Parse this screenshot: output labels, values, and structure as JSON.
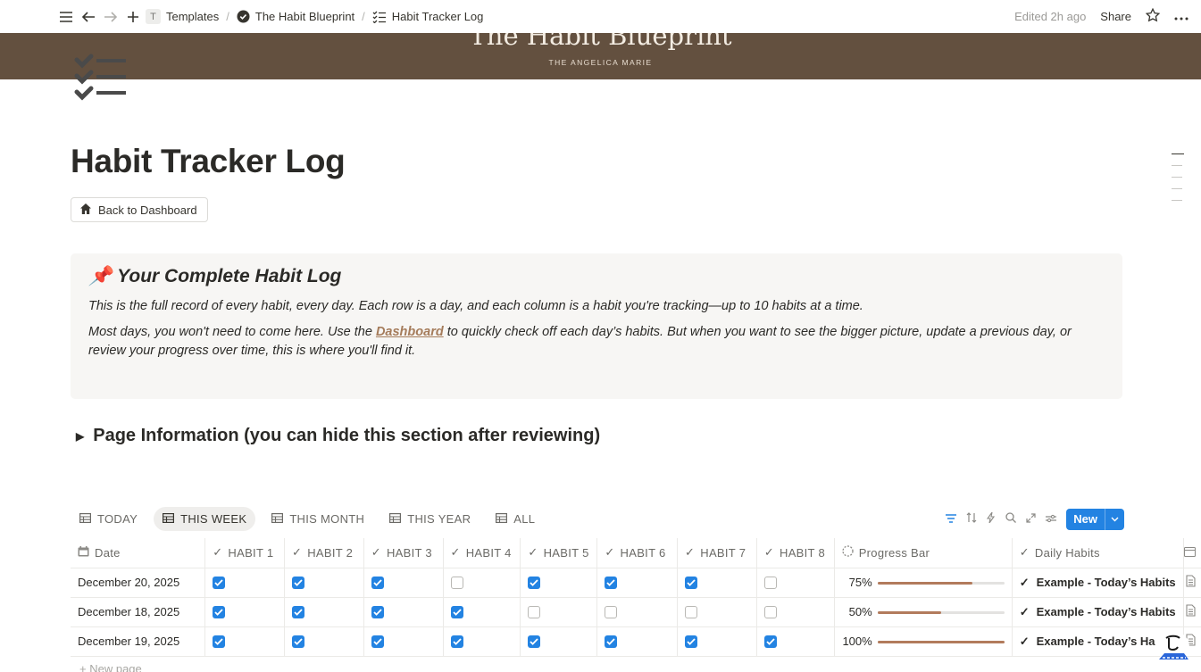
{
  "topbar": {
    "breadcrumb": [
      {
        "label": "Templates",
        "badge": "T"
      },
      {
        "label": "The Habit Blueprint",
        "icon": "check-circle-icon"
      },
      {
        "label": "Habit Tracker Log",
        "icon": "checklist-icon"
      }
    ],
    "edited": "Edited 2h ago",
    "share": "Share"
  },
  "banner": {
    "title": "The Habit Blueprint",
    "subtitle": "THE ANGELICA MARIE"
  },
  "page": {
    "title": "Habit Tracker Log",
    "back_button": "Back to Dashboard"
  },
  "callout": {
    "emoji": "📌",
    "heading": "Your Complete Habit Log",
    "p1": "This is the full record of every habit, every day. Each row is a day, and each column is a habit you're tracking—up to 10 habits at a time.",
    "p2_before": "Most days, you won't need to come here. Use the ",
    "p2_link": "Dashboard",
    "p2_after": " to quickly check off each day’s habits. But when you want to see the bigger picture, update a previous day, or review your progress over time, this is where you'll find it."
  },
  "toggle": {
    "label": "Page Information (you can hide this section after reviewing)"
  },
  "views": {
    "tabs": [
      "TODAY",
      "THIS WEEK",
      "THIS MONTH",
      "THIS YEAR",
      "ALL"
    ],
    "active": "THIS WEEK",
    "new_label": "New"
  },
  "table": {
    "columns": [
      "Date",
      "HABIT 1",
      "HABIT 2",
      "HABIT 3",
      "HABIT 4",
      "HABIT 5",
      "HABIT 6",
      "HABIT 7",
      "HABIT 8",
      "Progress Bar",
      "Daily Habits"
    ],
    "rows": [
      {
        "date": "December 20, 2025",
        "habits": [
          true,
          true,
          true,
          false,
          true,
          true,
          true,
          false
        ],
        "progress_label": "75%",
        "progress": 0.75,
        "daily": "Example - Today’s Habits"
      },
      {
        "date": "December 18, 2025",
        "habits": [
          true,
          true,
          true,
          true,
          false,
          false,
          false,
          false
        ],
        "progress_label": "50%",
        "progress": 0.5,
        "daily": "Example - Today’s Habits"
      },
      {
        "date": "December 19, 2025",
        "habits": [
          true,
          true,
          true,
          true,
          true,
          true,
          true,
          true
        ],
        "progress_label": "100%",
        "progress": 1.0,
        "daily": "Example - Today’s Ha"
      }
    ],
    "new_page": "New page"
  },
  "colors": {
    "banner": "#63503f",
    "accent": "#2383e2",
    "progress": "#b27b5c",
    "link": "#a57c5b"
  }
}
